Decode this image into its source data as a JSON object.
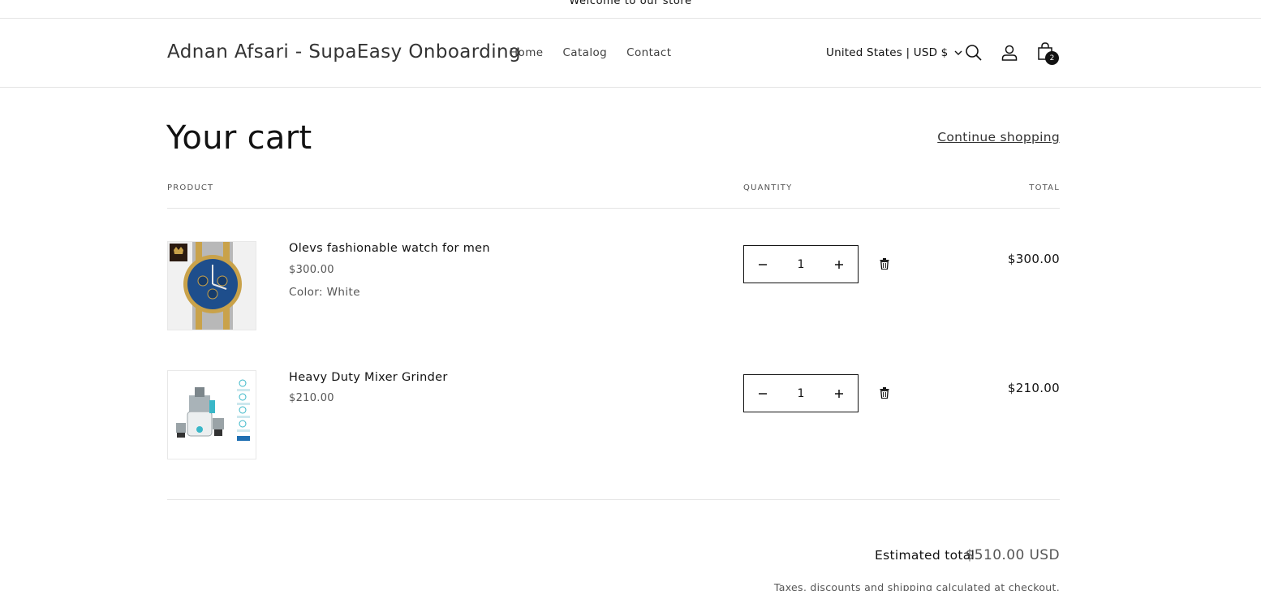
{
  "announcement": {
    "text": "Welcome to our store"
  },
  "header": {
    "logo": "Adnan Afsari - SupaEasy Onboarding",
    "nav": [
      "Home",
      "Catalog",
      "Contact"
    ],
    "country": "United States | USD $",
    "cart_count": "2",
    "icons": [
      "search-icon",
      "account-icon",
      "cart-icon",
      "chevron-down-icon"
    ]
  },
  "cart": {
    "title": "Your cart",
    "continue_label": "Continue shopping",
    "columns": {
      "product": "PRODUCT",
      "quantity": "QUANTITY",
      "total": "TOTAL"
    },
    "items": [
      {
        "name": "Olevs fashionable watch for men",
        "price": "$300.00",
        "option": "Color: White",
        "quantity": "1",
        "total": "$300.00"
      },
      {
        "name": "Heavy Duty Mixer Grinder",
        "price": "$210.00",
        "quantity": "1",
        "total": "$210.00"
      }
    ],
    "estimated_label": "Estimated total",
    "estimated_value": "$510.00 USD",
    "taxes_note": "Taxes, discounts and shipping calculated at checkout."
  },
  "colors": {
    "text": "#121212",
    "muted": "#555555",
    "border": "#e4e4e4",
    "badge": "#121212"
  }
}
